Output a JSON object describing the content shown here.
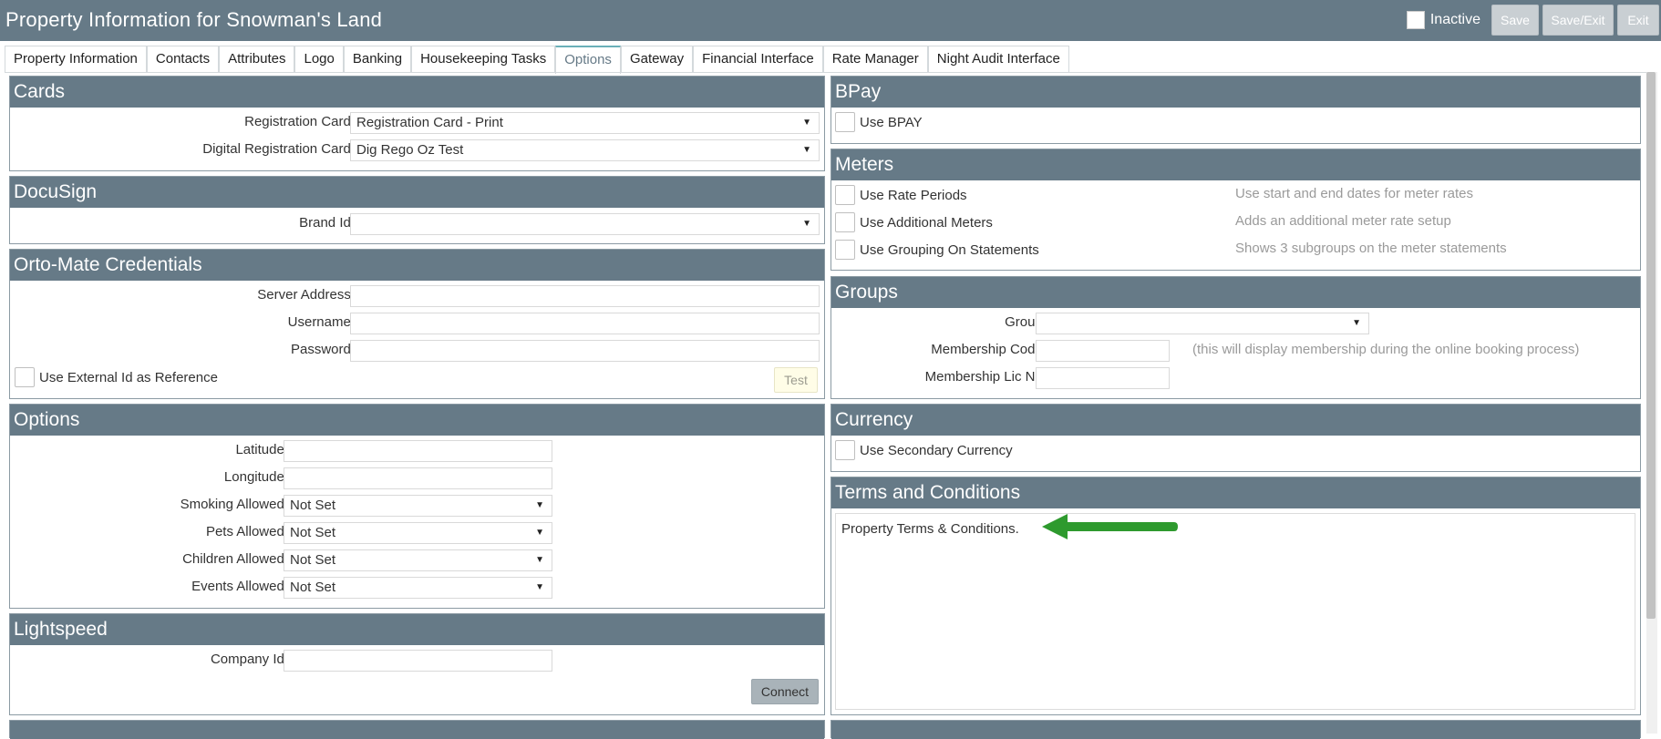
{
  "header": {
    "title": "Property Information for Snowman's Land",
    "inactive_label": "Inactive",
    "save_label": "Save",
    "save_exit_label": "Save/Exit",
    "exit_label": "Exit"
  },
  "tabs": [
    {
      "label": "Property Information"
    },
    {
      "label": "Contacts"
    },
    {
      "label": "Attributes"
    },
    {
      "label": "Logo"
    },
    {
      "label": "Banking"
    },
    {
      "label": "Housekeeping Tasks"
    },
    {
      "label": "Options",
      "active": true
    },
    {
      "label": "Gateway"
    },
    {
      "label": "Financial Interface"
    },
    {
      "label": "Rate Manager"
    },
    {
      "label": "Night Audit Interface"
    }
  ],
  "cards": {
    "title": "Cards",
    "registration_card_label": "Registration Card:",
    "registration_card_value": "Registration Card - Print",
    "digital_registration_card_label": "Digital Registration Card:",
    "digital_registration_card_value": "Dig Rego Oz Test"
  },
  "docusign": {
    "title": "DocuSign",
    "brand_id_label": "Brand Id:",
    "brand_id_value": ""
  },
  "ortomate": {
    "title": "Orto-Mate Credentials",
    "server_label": "Server Address:",
    "username_label": "Username:",
    "password_label": "Password:",
    "external_id_label": "Use External Id as Reference",
    "test_label": "Test"
  },
  "options": {
    "title": "Options",
    "latitude_label": "Latitude:",
    "longitude_label": "Longitude:",
    "smoking_label": "Smoking Allowed:",
    "smoking_value": "Not Set",
    "pets_label": "Pets Allowed:",
    "pets_value": "Not Set",
    "children_label": "Children Allowed:",
    "children_value": "Not Set",
    "events_label": "Events Allowed:",
    "events_value": "Not Set"
  },
  "lightspeed": {
    "title": "Lightspeed",
    "company_id_label": "Company Id:",
    "connect_label": "Connect"
  },
  "bpay": {
    "title": "BPay",
    "use_bpay_label": "Use BPAY"
  },
  "meters": {
    "title": "Meters",
    "items": [
      {
        "label": "Use Rate Periods",
        "hint": "Use start and end dates for meter rates"
      },
      {
        "label": "Use Additional Meters",
        "hint": "Adds an additional meter rate setup"
      },
      {
        "label": "Use Grouping On Statements",
        "hint": "Shows 3 subgroups on the meter statements"
      }
    ]
  },
  "groups": {
    "title": "Groups",
    "group_label": "Group:",
    "group_value": "",
    "membership_code_label": "Membership Code:",
    "membership_hint": "(this will display membership during the online booking process)",
    "membership_lic_label": "Membership Lic No:"
  },
  "currency": {
    "title": "Currency",
    "secondary_label": "Use Secondary Currency"
  },
  "terms": {
    "title": "Terms and Conditions",
    "text": "Property Terms & Conditions."
  },
  "colors": {
    "header_bg": "#667a87",
    "arrow": "#2e9a2e"
  },
  "icons": {
    "dropdown": "caret-down-icon",
    "annotation": "arrow-left-icon"
  }
}
